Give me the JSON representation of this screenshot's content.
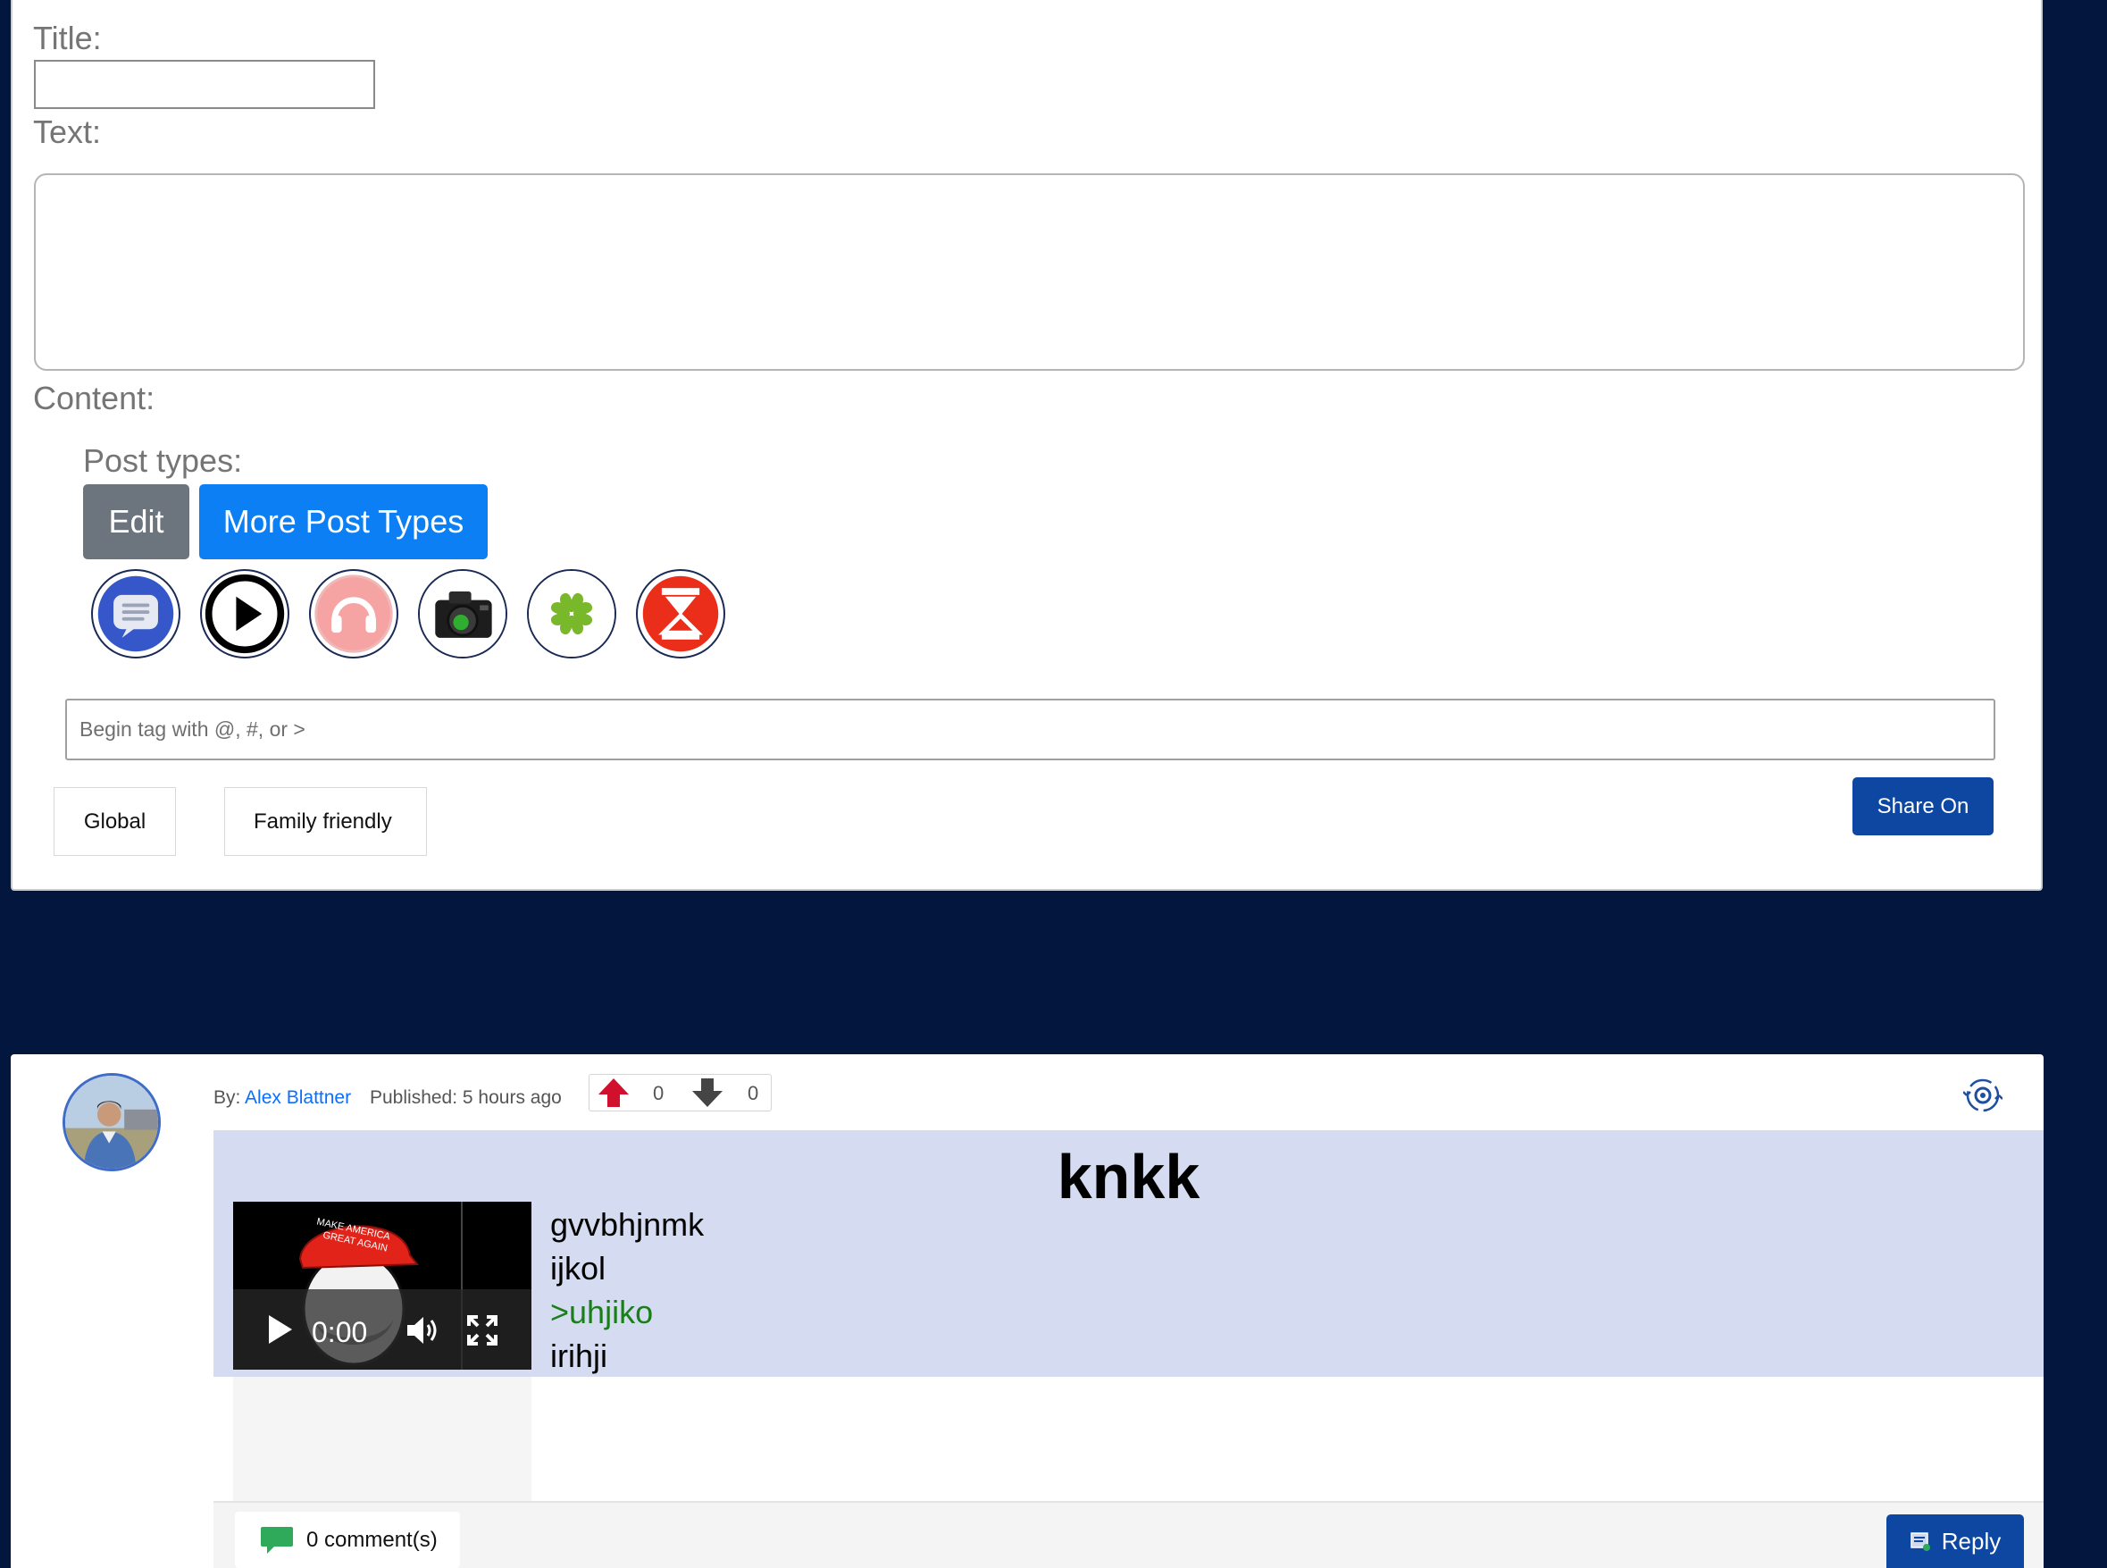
{
  "compose": {
    "title_label": "Title:",
    "title_value": "",
    "text_label": "Text:",
    "text_value": "",
    "content_label": "Content:",
    "post_types_label": "Post types:",
    "edit_label": "Edit",
    "more_types_label": "More Post Types",
    "post_type_icons": [
      "message-icon",
      "play-icon",
      "headphones-icon",
      "camera-icon",
      "clover-icon",
      "hourglass-icon"
    ],
    "tag_placeholder": "Begin tag with @, #, or >",
    "options": [
      "Global",
      "Family friendly"
    ],
    "share_label": "Share On"
  },
  "post": {
    "by_label": "By:",
    "author": "Alex Blattner",
    "published": "Published: 5 hours ago",
    "upvotes": "0",
    "downvotes": "0",
    "title": "knkk",
    "video": {
      "time": "0:00",
      "cap_text_line1": "MAKE AMERICA",
      "cap_text_line2": "GREAT AGAIN"
    },
    "lines": [
      {
        "text": "gvvbhjnmk",
        "greentext": false
      },
      {
        "text": "ijkol",
        "greentext": false
      },
      {
        "text": ">uhjiko",
        "greentext": true
      },
      {
        "text": "irihji",
        "greentext": false
      }
    ],
    "comments": "0 comment(s)",
    "reply_label": "Reply"
  },
  "colors": {
    "background": "#03163d",
    "primary": "#0d47a1",
    "accent": "#0d7ff5",
    "content_band": "#d5dbf0",
    "greentext": "#1a7f1a"
  }
}
